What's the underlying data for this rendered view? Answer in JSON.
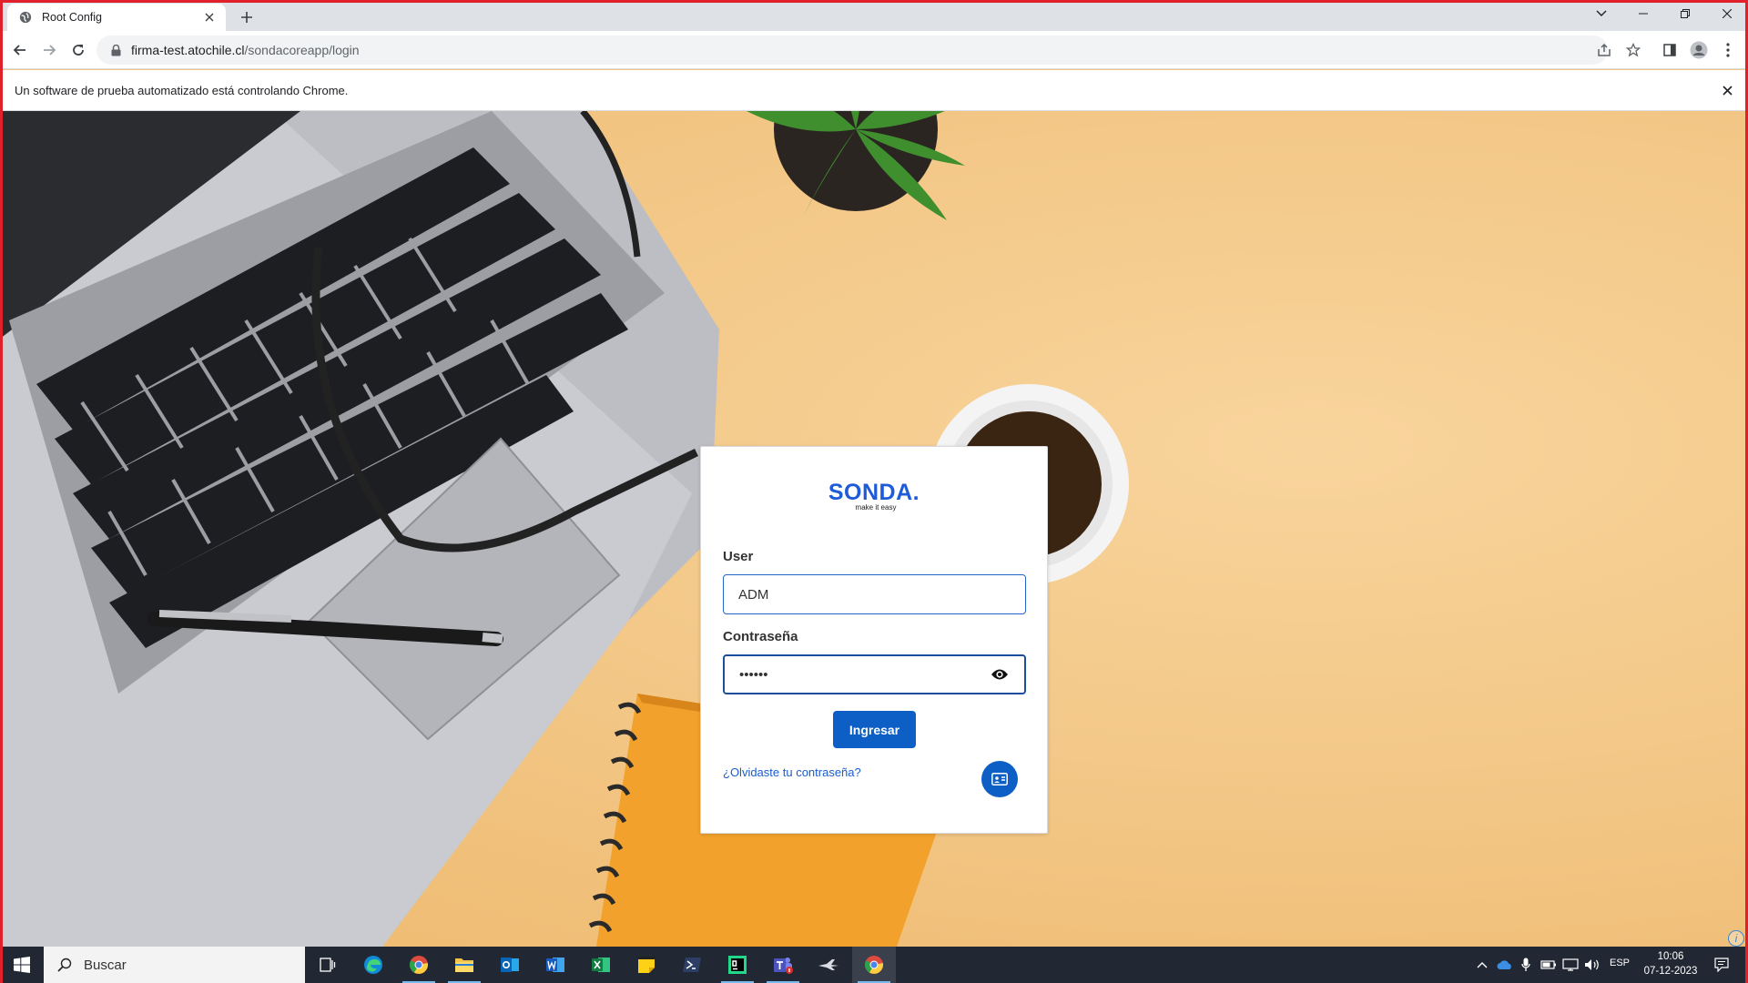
{
  "browser": {
    "tab_title": "Root Config",
    "url_domain": "firma-test.atochile.cl",
    "url_path": "/sondacoreapp/login",
    "infobar_text": "Un software de prueba automatizado está controlando Chrome."
  },
  "login": {
    "brand_name": "SONDA.",
    "brand_tagline": "make it easy",
    "user_label": "User",
    "user_value": "ADM",
    "password_label": "Contraseña",
    "password_value": "••••••",
    "submit_label": "Ingresar",
    "forgot_link": "¿Olvidaste tu contraseña?"
  },
  "taskbar": {
    "search_placeholder": "Buscar",
    "pinned": [
      "task-view",
      "edge",
      "chrome",
      "file-explorer",
      "outlook",
      "word",
      "excel",
      "sticky-notes",
      "powershell",
      "pycharm",
      "teams",
      "app-plane",
      "chrome-active"
    ],
    "language": "ESP",
    "time": "10:06",
    "date": "07-12-2023"
  },
  "colors": {
    "accent": "#0d5fc5",
    "brand_blue": "#1e5bd8",
    "window_border": "#e0202a",
    "taskbar": "#222833"
  }
}
